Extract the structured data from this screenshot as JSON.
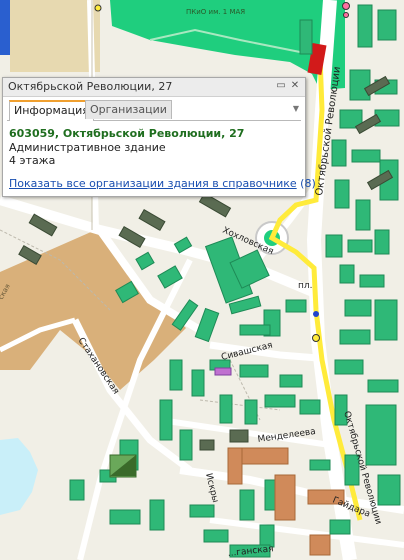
{
  "map": {
    "labels": {
      "park": "ПКиО им. 1 МАЯ",
      "oktyabrskoy_revolyutsii": "Октябрьской Революции",
      "khohlovskaya": "Хохловская",
      "pl": "пл.",
      "sivashskaya": "Сивашская",
      "mendeleeva": "Менделеева",
      "oktyabrskoy_lower": "Октябрьской Революции",
      "stakhanovskaya": "Стахановская",
      "iskry": "Искры",
      "gaydara": "Гайдара",
      "aganskaya": "...ганская",
      "left_edge": "ская"
    },
    "colors": {
      "background": "#f1efe6",
      "park": "#1fce7e",
      "building": "#2fb877",
      "industrial": "#d9b07a",
      "water": "#c9eff9",
      "route": "#ffeb3b",
      "highlighted_building": "#d08a5a"
    }
  },
  "popup": {
    "title": "Октябрьской Революции, 27",
    "tabs": [
      "Информация",
      "Организации"
    ],
    "address": "603059, Октябрьской Революции, 27",
    "building_type": "Административное здание",
    "floors": "4 этажа",
    "link_text": "Показать все организации здания в справочнике",
    "link_count": "(8)",
    "buttons": {
      "pin": "▭",
      "close": "✕"
    },
    "tab_scroll_icon": "▼"
  }
}
